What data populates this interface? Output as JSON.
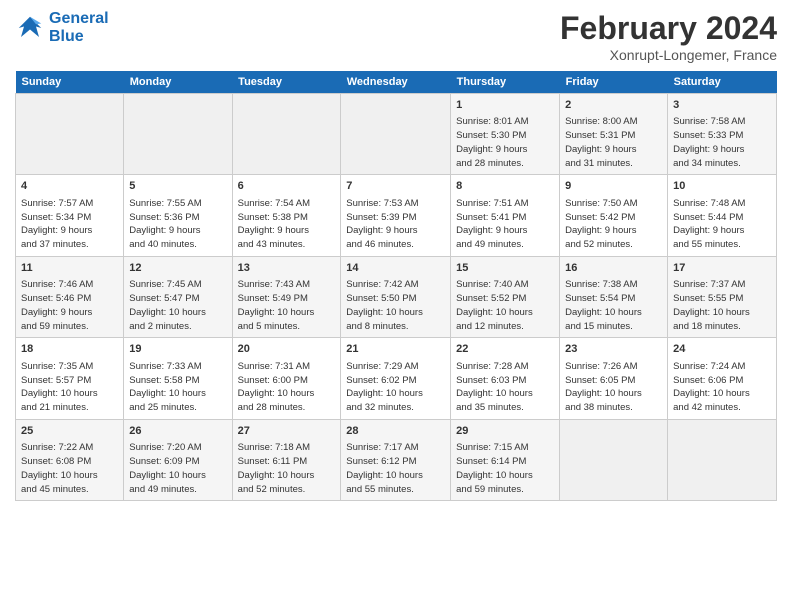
{
  "header": {
    "logo_line1": "General",
    "logo_line2": "Blue",
    "month": "February 2024",
    "location": "Xonrupt-Longemer, France"
  },
  "weekdays": [
    "Sunday",
    "Monday",
    "Tuesday",
    "Wednesday",
    "Thursday",
    "Friday",
    "Saturday"
  ],
  "weeks": [
    [
      {
        "day": "",
        "info": ""
      },
      {
        "day": "",
        "info": ""
      },
      {
        "day": "",
        "info": ""
      },
      {
        "day": "",
        "info": ""
      },
      {
        "day": "1",
        "info": "Sunrise: 8:01 AM\nSunset: 5:30 PM\nDaylight: 9 hours\nand 28 minutes."
      },
      {
        "day": "2",
        "info": "Sunrise: 8:00 AM\nSunset: 5:31 PM\nDaylight: 9 hours\nand 31 minutes."
      },
      {
        "day": "3",
        "info": "Sunrise: 7:58 AM\nSunset: 5:33 PM\nDaylight: 9 hours\nand 34 minutes."
      }
    ],
    [
      {
        "day": "4",
        "info": "Sunrise: 7:57 AM\nSunset: 5:34 PM\nDaylight: 9 hours\nand 37 minutes."
      },
      {
        "day": "5",
        "info": "Sunrise: 7:55 AM\nSunset: 5:36 PM\nDaylight: 9 hours\nand 40 minutes."
      },
      {
        "day": "6",
        "info": "Sunrise: 7:54 AM\nSunset: 5:38 PM\nDaylight: 9 hours\nand 43 minutes."
      },
      {
        "day": "7",
        "info": "Sunrise: 7:53 AM\nSunset: 5:39 PM\nDaylight: 9 hours\nand 46 minutes."
      },
      {
        "day": "8",
        "info": "Sunrise: 7:51 AM\nSunset: 5:41 PM\nDaylight: 9 hours\nand 49 minutes."
      },
      {
        "day": "9",
        "info": "Sunrise: 7:50 AM\nSunset: 5:42 PM\nDaylight: 9 hours\nand 52 minutes."
      },
      {
        "day": "10",
        "info": "Sunrise: 7:48 AM\nSunset: 5:44 PM\nDaylight: 9 hours\nand 55 minutes."
      }
    ],
    [
      {
        "day": "11",
        "info": "Sunrise: 7:46 AM\nSunset: 5:46 PM\nDaylight: 9 hours\nand 59 minutes."
      },
      {
        "day": "12",
        "info": "Sunrise: 7:45 AM\nSunset: 5:47 PM\nDaylight: 10 hours\nand 2 minutes."
      },
      {
        "day": "13",
        "info": "Sunrise: 7:43 AM\nSunset: 5:49 PM\nDaylight: 10 hours\nand 5 minutes."
      },
      {
        "day": "14",
        "info": "Sunrise: 7:42 AM\nSunset: 5:50 PM\nDaylight: 10 hours\nand 8 minutes."
      },
      {
        "day": "15",
        "info": "Sunrise: 7:40 AM\nSunset: 5:52 PM\nDaylight: 10 hours\nand 12 minutes."
      },
      {
        "day": "16",
        "info": "Sunrise: 7:38 AM\nSunset: 5:54 PM\nDaylight: 10 hours\nand 15 minutes."
      },
      {
        "day": "17",
        "info": "Sunrise: 7:37 AM\nSunset: 5:55 PM\nDaylight: 10 hours\nand 18 minutes."
      }
    ],
    [
      {
        "day": "18",
        "info": "Sunrise: 7:35 AM\nSunset: 5:57 PM\nDaylight: 10 hours\nand 21 minutes."
      },
      {
        "day": "19",
        "info": "Sunrise: 7:33 AM\nSunset: 5:58 PM\nDaylight: 10 hours\nand 25 minutes."
      },
      {
        "day": "20",
        "info": "Sunrise: 7:31 AM\nSunset: 6:00 PM\nDaylight: 10 hours\nand 28 minutes."
      },
      {
        "day": "21",
        "info": "Sunrise: 7:29 AM\nSunset: 6:02 PM\nDaylight: 10 hours\nand 32 minutes."
      },
      {
        "day": "22",
        "info": "Sunrise: 7:28 AM\nSunset: 6:03 PM\nDaylight: 10 hours\nand 35 minutes."
      },
      {
        "day": "23",
        "info": "Sunrise: 7:26 AM\nSunset: 6:05 PM\nDaylight: 10 hours\nand 38 minutes."
      },
      {
        "day": "24",
        "info": "Sunrise: 7:24 AM\nSunset: 6:06 PM\nDaylight: 10 hours\nand 42 minutes."
      }
    ],
    [
      {
        "day": "25",
        "info": "Sunrise: 7:22 AM\nSunset: 6:08 PM\nDaylight: 10 hours\nand 45 minutes."
      },
      {
        "day": "26",
        "info": "Sunrise: 7:20 AM\nSunset: 6:09 PM\nDaylight: 10 hours\nand 49 minutes."
      },
      {
        "day": "27",
        "info": "Sunrise: 7:18 AM\nSunset: 6:11 PM\nDaylight: 10 hours\nand 52 minutes."
      },
      {
        "day": "28",
        "info": "Sunrise: 7:17 AM\nSunset: 6:12 PM\nDaylight: 10 hours\nand 55 minutes."
      },
      {
        "day": "29",
        "info": "Sunrise: 7:15 AM\nSunset: 6:14 PM\nDaylight: 10 hours\nand 59 minutes."
      },
      {
        "day": "",
        "info": ""
      },
      {
        "day": "",
        "info": ""
      }
    ]
  ]
}
